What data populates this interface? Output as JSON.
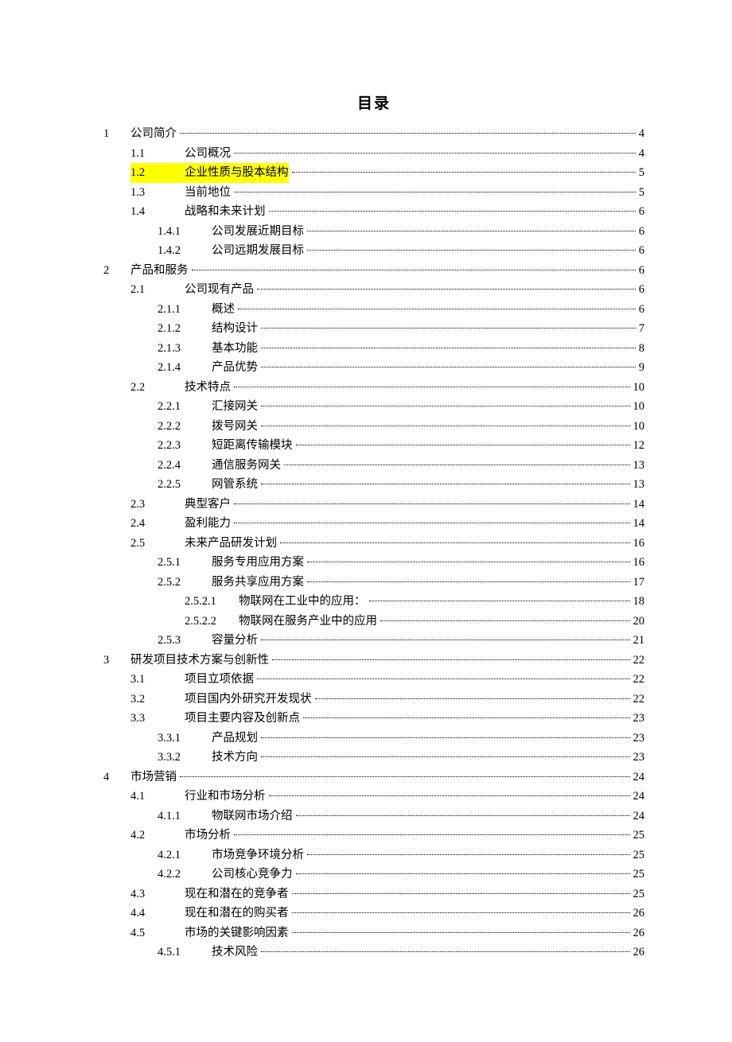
{
  "title": "目录",
  "entries": [
    {
      "level": 1,
      "num": "1",
      "label": "公司简介",
      "page": "4",
      "hl": false
    },
    {
      "level": 2,
      "num": "1.1",
      "label": "公司概况",
      "page": "4",
      "hl": false
    },
    {
      "level": 2,
      "num": "1.2",
      "label": "企业性质与股本结构",
      "page": "5",
      "hl": true
    },
    {
      "level": 2,
      "num": "1.3",
      "label": "当前地位",
      "page": "5",
      "hl": false
    },
    {
      "level": 2,
      "num": "1.4",
      "label": "战略和未来计划",
      "page": "6",
      "hl": false
    },
    {
      "level": 3,
      "num": "1.4.1",
      "label": "公司发展近期目标",
      "page": "6",
      "hl": false
    },
    {
      "level": 3,
      "num": "1.4.2",
      "label": "公司远期发展目标",
      "page": "6",
      "hl": false
    },
    {
      "level": 1,
      "num": "2",
      "label": "产品和服务",
      "page": "6",
      "hl": false
    },
    {
      "level": 2,
      "num": "2.1",
      "label": "公司现有产品",
      "page": "6",
      "hl": false
    },
    {
      "level": 3,
      "num": "2.1.1",
      "label": "概述",
      "page": "6",
      "hl": false
    },
    {
      "level": 3,
      "num": "2.1.2",
      "label": "结构设计",
      "page": "7",
      "hl": false
    },
    {
      "level": 3,
      "num": "2.1.3",
      "label": "基本功能",
      "page": "8",
      "hl": false
    },
    {
      "level": 3,
      "num": "2.1.4",
      "label": "产品优势",
      "page": "9",
      "hl": false
    },
    {
      "level": 2,
      "num": "2.2",
      "label": "技术特点",
      "page": "10",
      "hl": false
    },
    {
      "level": 3,
      "num": "2.2.1",
      "label": "汇接网关",
      "page": "10",
      "hl": false
    },
    {
      "level": 3,
      "num": "2.2.2",
      "label": "拨号网关",
      "page": "10",
      "hl": false
    },
    {
      "level": 3,
      "num": "2.2.3",
      "label": "短距离传输模块",
      "page": "12",
      "hl": false
    },
    {
      "level": 3,
      "num": "2.2.4",
      "label": "通信服务网关",
      "page": "13",
      "hl": false
    },
    {
      "level": 3,
      "num": "2.2.5",
      "label": "网管系统",
      "page": "13",
      "hl": false
    },
    {
      "level": 2,
      "num": "2.3",
      "label": "典型客户",
      "page": "14",
      "hl": false
    },
    {
      "level": 2,
      "num": "2.4",
      "label": "盈利能力",
      "page": "14",
      "hl": false
    },
    {
      "level": 2,
      "num": "2.5",
      "label": "未来产品研发计划",
      "page": "16",
      "hl": false
    },
    {
      "level": 3,
      "num": "2.5.1",
      "label": "服务专用应用方案",
      "page": "16",
      "hl": false
    },
    {
      "level": 3,
      "num": "2.5.2",
      "label": "服务共享应用方案",
      "page": "17",
      "hl": false
    },
    {
      "level": 4,
      "num": "2.5.2.1",
      "label": "物联网在工业中的应用：",
      "page": "18",
      "hl": false
    },
    {
      "level": 4,
      "num": "2.5.2.2",
      "label": "物联网在服务产业中的应用",
      "page": "20",
      "hl": false
    },
    {
      "level": 3,
      "num": "2.5.3",
      "label": "容量分析",
      "page": "21",
      "hl": false
    },
    {
      "level": 1,
      "num": "3",
      "label": "研发项目技术方案与创新性",
      "page": "22",
      "hl": false
    },
    {
      "level": 2,
      "num": "3.1",
      "label": "项目立项依据",
      "page": "22",
      "hl": false
    },
    {
      "level": 2,
      "num": "3.2",
      "label": "项目国内外研究开发现状",
      "page": "22",
      "hl": false
    },
    {
      "level": 2,
      "num": "3.3",
      "label": "项目主要内容及创新点",
      "page": "23",
      "hl": false
    },
    {
      "level": 3,
      "num": "3.3.1",
      "label": "产品规划",
      "page": "23",
      "hl": false
    },
    {
      "level": 3,
      "num": "3.3.2",
      "label": "技术方向",
      "page": "23",
      "hl": false
    },
    {
      "level": 1,
      "num": "4",
      "label": "市场营销",
      "page": "24",
      "hl": false
    },
    {
      "level": 2,
      "num": "4.1",
      "label": "行业和市场分析",
      "page": "24",
      "hl": false
    },
    {
      "level": 3,
      "num": "4.1.1",
      "label": "物联网市场介绍",
      "page": "24",
      "hl": false
    },
    {
      "level": 2,
      "num": "4.2",
      "label": "市场分析",
      "page": "25",
      "hl": false
    },
    {
      "level": 3,
      "num": "4.2.1",
      "label": "市场竞争环境分析",
      "page": "25",
      "hl": false
    },
    {
      "level": 3,
      "num": "4.2.2",
      "label": "公司核心竞争力",
      "page": "25",
      "hl": false
    },
    {
      "level": 2,
      "num": "4.3",
      "label": "现在和潜在的竞争者",
      "page": "25",
      "hl": false
    },
    {
      "level": 2,
      "num": "4.4",
      "label": "现在和潜在的购买者",
      "page": "26",
      "hl": false
    },
    {
      "level": 2,
      "num": "4.5",
      "label": "市场的关键影响因素",
      "page": "26",
      "hl": false
    },
    {
      "level": 3,
      "num": "4.5.1",
      "label": "技术风险",
      "page": "26",
      "hl": false
    }
  ]
}
